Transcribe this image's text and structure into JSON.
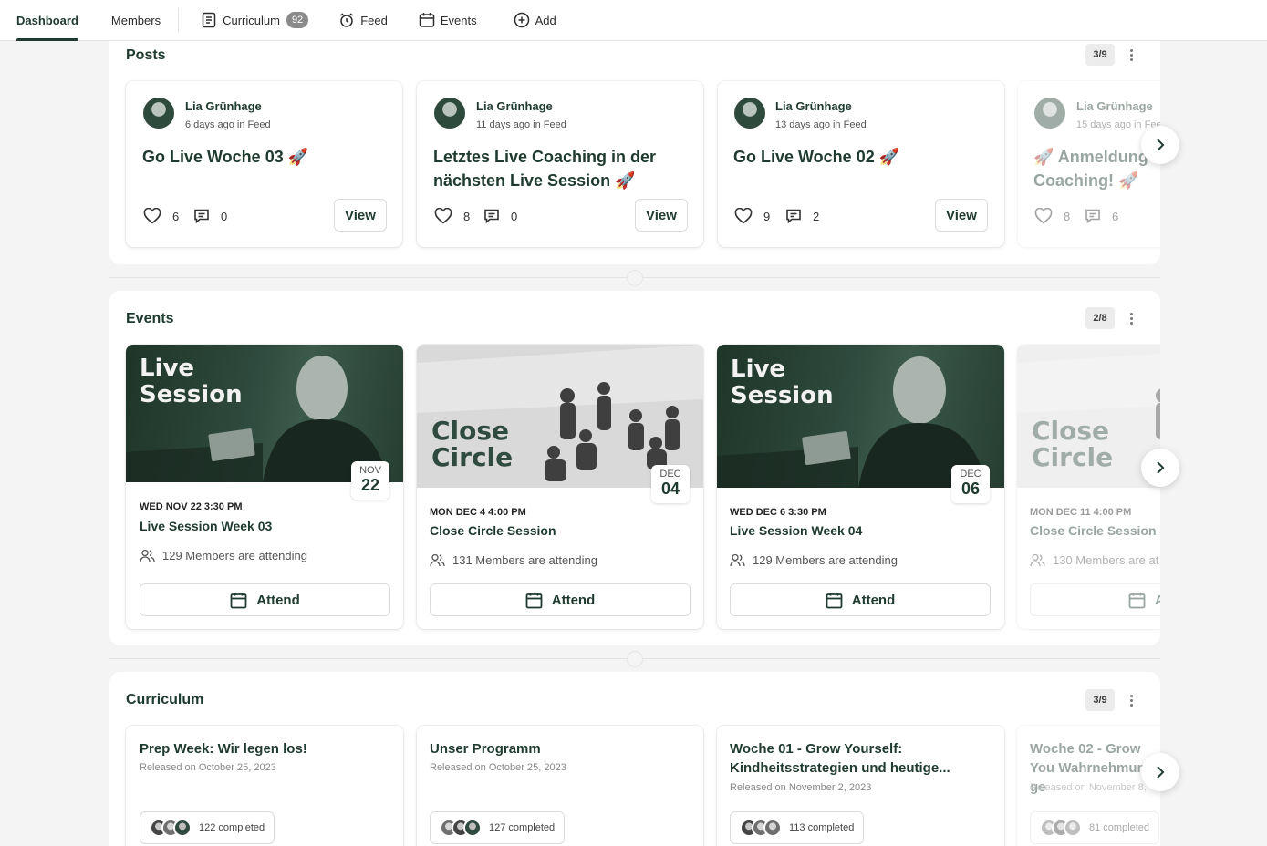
{
  "nav": {
    "dashboard": "Dashboard",
    "members": "Members",
    "curriculum": "Curriculum",
    "curriculum_count": "92",
    "feed": "Feed",
    "events": "Events",
    "add": "Add"
  },
  "posts": {
    "title": "Posts",
    "pager": "3/9",
    "cards": [
      {
        "author": "Lia Grünhage",
        "meta": "6 days ago in Feed",
        "title": "Go Live Woche 03 🚀",
        "likes": "6",
        "comments": "0",
        "view": "View"
      },
      {
        "author": "Lia Grünhage",
        "meta": "11 days ago in Feed",
        "title": "Letztes Live Coaching in der nächsten Live Session 🚀",
        "likes": "8",
        "comments": "0",
        "view": "View"
      },
      {
        "author": "Lia Grünhage",
        "meta": "13 days ago in Feed",
        "title": "Go Live Woche 02 🚀",
        "likes": "9",
        "comments": "2",
        "view": "View"
      },
      {
        "author": "Lia Grünhage",
        "meta": "15 days ago in Feed",
        "title": "🚀 Anmeldung Coaching! 🚀",
        "likes": "8",
        "comments": "6"
      }
    ]
  },
  "events": {
    "title": "Events",
    "pager": "2/8",
    "cards": [
      {
        "image_text": "Live\nSession",
        "month": "NOV",
        "day": "22",
        "time": "WED NOV 22 3:30 PM",
        "title": "Live Session Week 03",
        "attending": "129 Members are attending",
        "button": "Attend"
      },
      {
        "image_text": "Close\nCircle",
        "month": "DEC",
        "day": "04",
        "time": "MON DEC 4 4:00 PM",
        "title": "Close Circle Session",
        "attending": "131 Members are attending",
        "button": "Attend"
      },
      {
        "image_text": "Live\nSession",
        "month": "DEC",
        "day": "06",
        "time": "WED DEC 6 3:30 PM",
        "title": "Live Session Week 04",
        "attending": "129 Members are attending",
        "button": "Attend"
      },
      {
        "image_text": "Close\nCircle",
        "time": "MON DEC 11 4:00 PM",
        "title": "Close Circle Session",
        "attending": "130 Members are at",
        "button": "A"
      }
    ]
  },
  "curriculum": {
    "title": "Curriculum",
    "pager": "3/9",
    "cards": [
      {
        "title": "Prep Week: Wir legen los!",
        "released": "Released on October 25, 2023",
        "completed": "122 completed"
      },
      {
        "title": "Unser Programm",
        "released": "Released on October 25, 2023",
        "completed": "127 completed"
      },
      {
        "title": "Woche 01 - Grow Yourself: Kindheitsstrategien und heutige...",
        "released": "Released on November 2, 2023",
        "completed": "113 completed"
      },
      {
        "title": "Woche 02 - Grow You Wahrnehmung ge",
        "released": "Released on November 8,",
        "completed": "81 completed"
      }
    ]
  },
  "colors": {
    "brand": "#1f3a2e",
    "page_bg": "#f4f4f4",
    "image_dark": "#2f4a3e",
    "image_light": "#dcdcdc"
  },
  "icons": [
    "curriculum-icon",
    "feed-icon",
    "events-icon",
    "add-icon",
    "heart-icon",
    "comment-icon",
    "members-icon",
    "calendar-icon",
    "chevron-right-icon",
    "kebab-icon"
  ]
}
